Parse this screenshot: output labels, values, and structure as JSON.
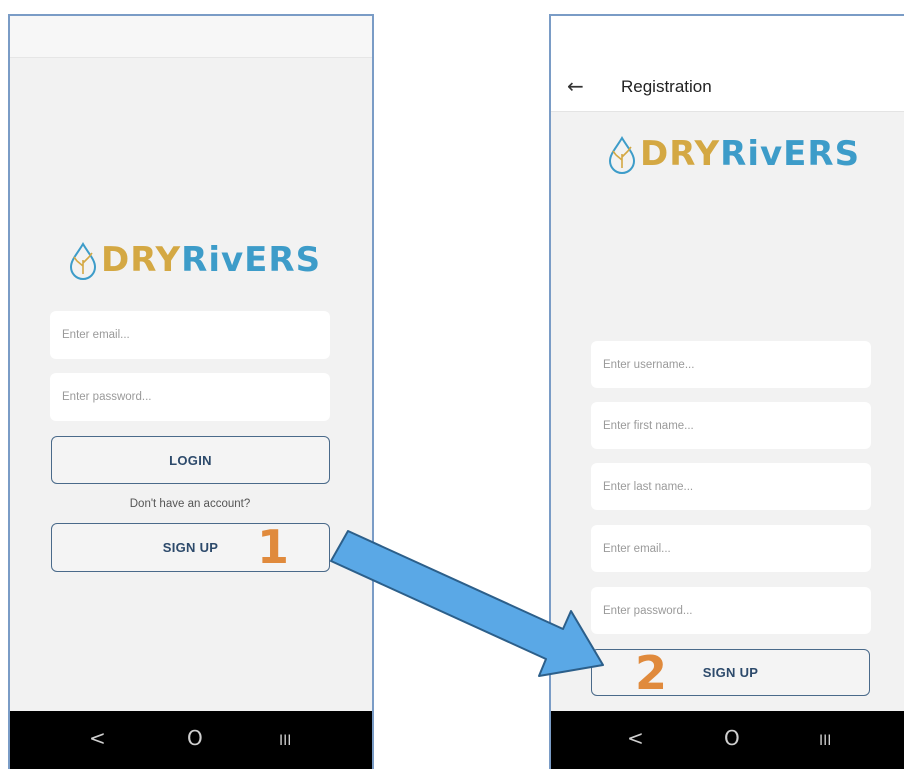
{
  "login_screen": {
    "logo": {
      "part1": "DRY",
      "part2": "RivERS"
    },
    "email_placeholder": "Enter email...",
    "password_placeholder": "Enter password...",
    "login_label": "LOGIN",
    "no_account_text": "Don't have an account?",
    "signup_label": "SIGN UP",
    "nav": {
      "back": "<",
      "home": "O",
      "recents": "III"
    }
  },
  "registration_screen": {
    "title": "Registration",
    "back_icon": "←",
    "logo": {
      "part1": "DRY",
      "part2": "RivERS"
    },
    "username_placeholder": "Enter username...",
    "first_name_placeholder": "Enter first name...",
    "last_name_placeholder": "Enter last name...",
    "email_placeholder": "Enter email...",
    "password_placeholder": "Enter password...",
    "signup_label": "SIGN UP",
    "nav": {
      "back": "<",
      "home": "O",
      "recents": "III"
    }
  },
  "annotations": {
    "step1": "1",
    "step2": "2"
  },
  "colors": {
    "logo_gold": "#d4a843",
    "logo_blue": "#3d9cc9",
    "button_border": "#4a6a8a",
    "step_orange": "#e08a3c",
    "arrow_fill": "#5aa8e6"
  },
  "icons": [
    "back-arrow-icon",
    "nav-back-icon",
    "nav-home-icon",
    "nav-recents-icon",
    "drop-tree-logo-icon",
    "flow-arrow-icon"
  ]
}
